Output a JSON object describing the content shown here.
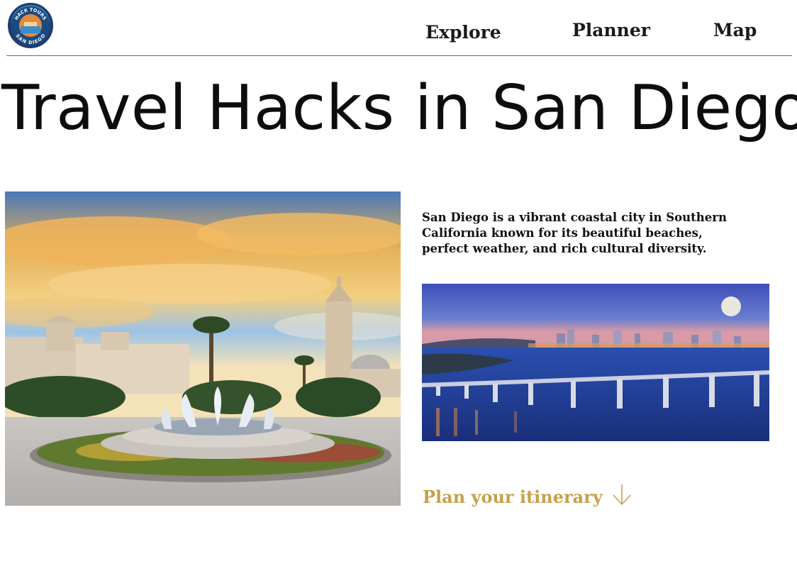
{
  "brand": {
    "logo_text_top": "HACK TOURS",
    "logo_text_bottom": "SAN DIEGO"
  },
  "nav": {
    "items": [
      {
        "label": "Explore"
      },
      {
        "label": "Planner"
      },
      {
        "label": "Map"
      }
    ]
  },
  "hero": {
    "title": "Travel Hacks in San Diego"
  },
  "content": {
    "intro": "San Diego is a vibrant coastal city in Southern California known for its beautiful beaches, perfect weather, and rich cultural diversity.",
    "cta_label": "Plan your itinerary",
    "cta_icon": "arrow-down-icon"
  },
  "colors": {
    "accent": "#c8a04c",
    "text": "#111111",
    "divider": "#6b6b6b"
  }
}
